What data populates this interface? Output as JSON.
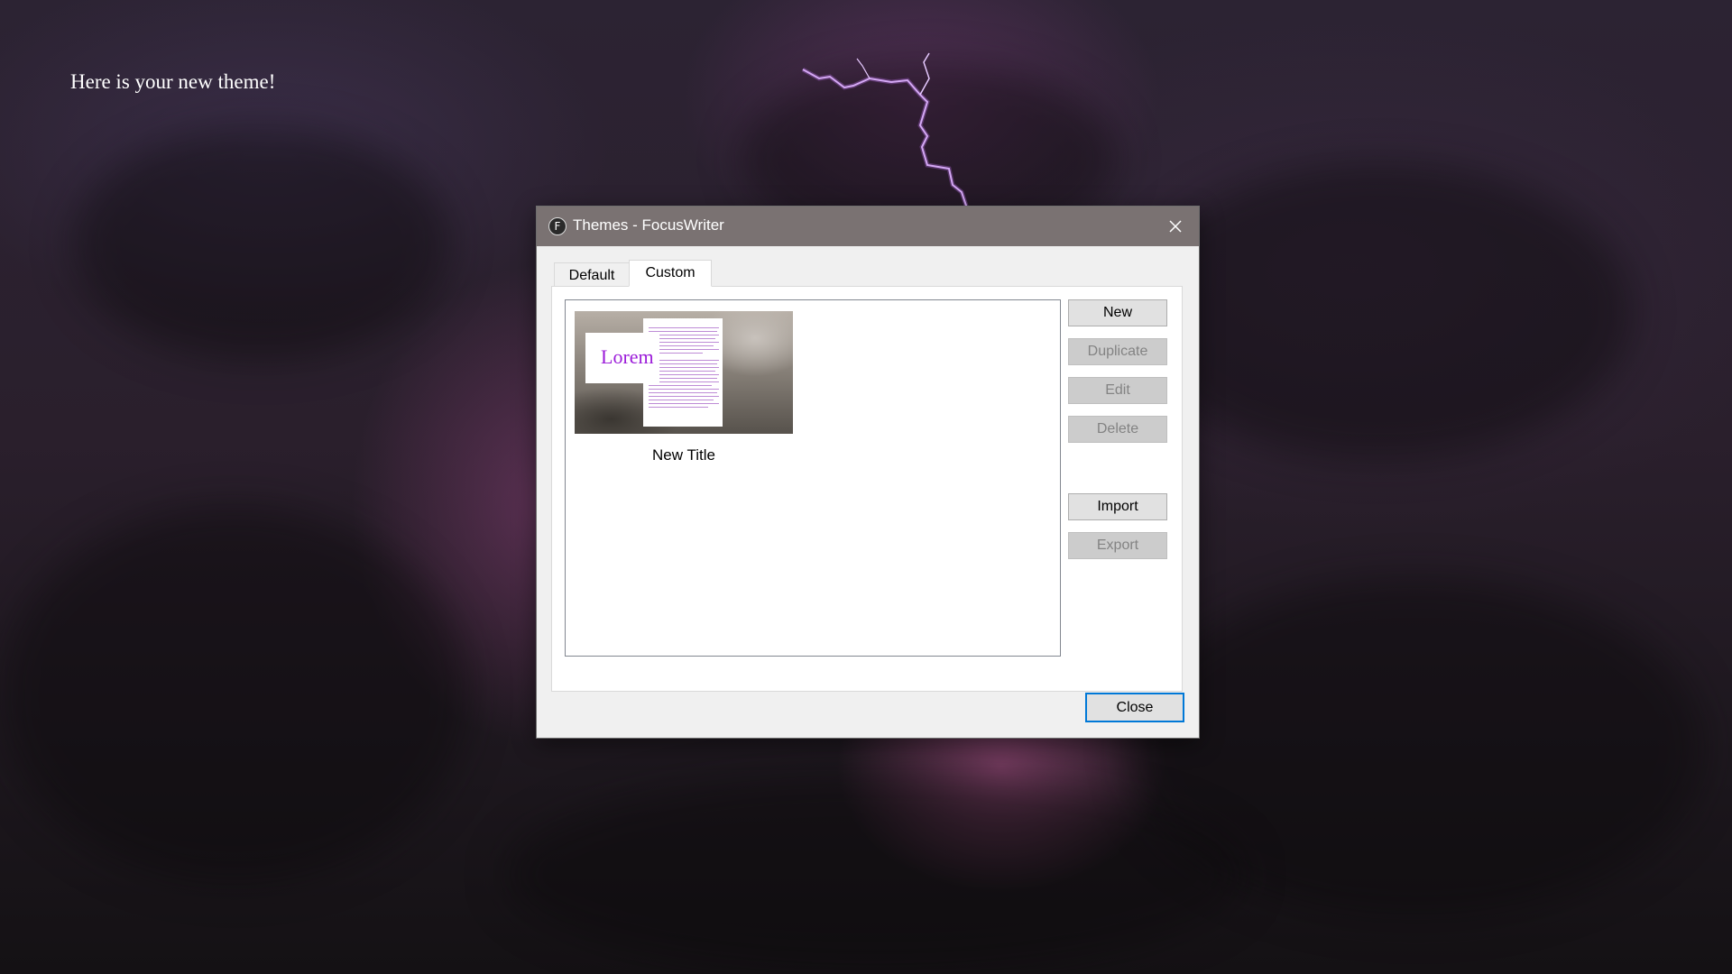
{
  "desktop": {
    "message": "Here is your new theme!"
  },
  "dialog": {
    "title": "Themes - FocusWriter",
    "app_icon_letter": "F",
    "icons": {
      "app": "focuswriter-app-icon",
      "close": "close-icon"
    },
    "tabs": [
      {
        "label": "Default",
        "selected": false
      },
      {
        "label": "Custom",
        "selected": true
      }
    ],
    "themes": [
      {
        "name": "New Title",
        "preview_text": "Lorem",
        "preview_text_color": "#9b1bd9",
        "selected": false
      }
    ],
    "buttons": {
      "new": {
        "label": "New",
        "enabled": true
      },
      "duplicate": {
        "label": "Duplicate",
        "enabled": false
      },
      "edit": {
        "label": "Edit",
        "enabled": false
      },
      "delete": {
        "label": "Delete",
        "enabled": false
      },
      "import": {
        "label": "Import",
        "enabled": true
      },
      "export": {
        "label": "Export",
        "enabled": false
      }
    },
    "close_button": "Close",
    "accent_color": "#0078d7"
  }
}
